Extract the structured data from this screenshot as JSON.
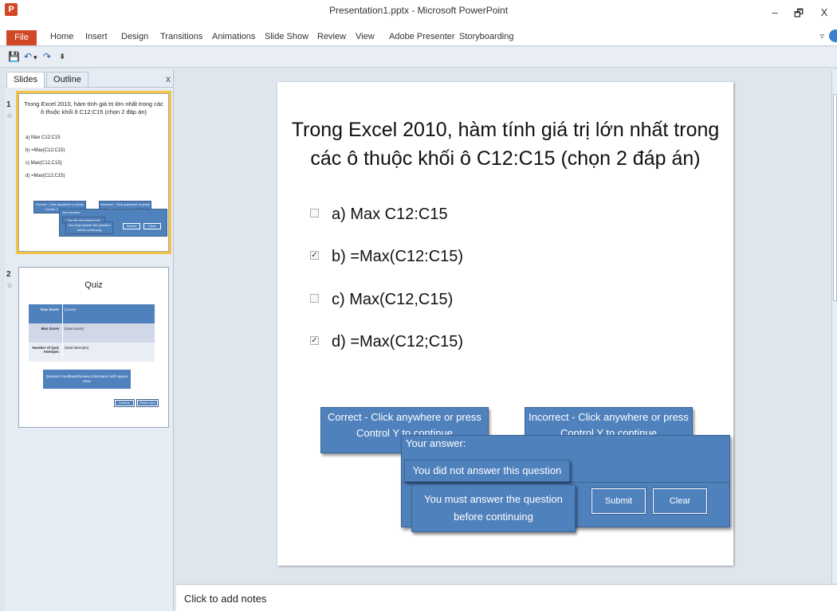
{
  "window": {
    "title": "Presentation1.pptx - Microsoft PowerPoint",
    "app_icon": "P",
    "minimize": "–",
    "restore": "🗗",
    "close": "X"
  },
  "ribbon": {
    "file": "File",
    "tabs": [
      "Home",
      "Insert",
      "Design",
      "Transitions",
      "Animations",
      "Slide Show",
      "Review",
      "View",
      "Adobe Presenter",
      "Storyboarding"
    ],
    "minimize_icon": "▿"
  },
  "qat": {
    "save_icon": "💾",
    "undo_icon": "↶",
    "undo_dropdown": "▾",
    "redo_icon": "↷",
    "customize": "⇟"
  },
  "panel": {
    "tabs": [
      "Slides",
      "Outline"
    ],
    "close": "x",
    "slide_numbers": [
      "1",
      "2"
    ],
    "star": "☆"
  },
  "thumb1": {
    "title": "Trong Excel 2010, hàm tính giá trị lớn nhất trong các ô thuộc khối ô C12:C15 (chọn 2 đáp án)",
    "options": [
      "a)  Max C12:C15",
      "b)  =Max(C12:C15)",
      "c)  Max(C12,C15)",
      "d)  =Max(C12;C15)"
    ],
    "correct": "Correct - Click anywhere or press Control Y to continue",
    "incorrect": "Incorrect - Click anywhere or press Control Y to continue",
    "your_answer": "Your answer:",
    "not_answered": "You did not answer this question",
    "must_answer": "You must answer the question before continuing",
    "submit": "Submit",
    "clear": "Clear"
  },
  "thumb2": {
    "title": "Quiz",
    "rows": [
      {
        "label": "Your Score",
        "value": "{score}"
      },
      {
        "label": "Max Score",
        "value": "{max-score}"
      },
      {
        "label": "Number of Quiz Attempts",
        "value": "{total-attempts}"
      }
    ],
    "feedback": "Question Feedback/Review Information Will Appear Here",
    "review": "Continue",
    "retake": "Review Quiz"
  },
  "slide": {
    "title": "Trong Excel 2010, hàm tính giá trị lớn nhất trong các ô thuộc khối ô C12:C15 (chọn 2 đáp án)",
    "options": [
      {
        "label": "a)  Max C12:C15",
        "checked": false,
        "mark": ""
      },
      {
        "label": "b)  =Max(C12:C15)",
        "checked": true,
        "mark": "✓"
      },
      {
        "label": "c)  Max(C12,C15)",
        "checked": false,
        "mark": ""
      },
      {
        "label": "d)  =Max(C12;C15)",
        "checked": true,
        "mark": "✓"
      }
    ],
    "correct_feedback": "Correct - Click anywhere or press Control Y to continue",
    "incorrect_feedback": "Incorrect - Click anywhere or press Control Y to continue",
    "your_answer": "Your answer:",
    "not_answered": "You did not answer this question",
    "must_answer": "You must answer the question before continuing",
    "submit": "Submit",
    "clear": "Clear"
  },
  "notes": {
    "placeholder": "Click to add notes"
  },
  "colors": {
    "file_tab": "#d24726",
    "feedback_box": "#4f81bd",
    "selected_thumb": "#f5c342"
  }
}
